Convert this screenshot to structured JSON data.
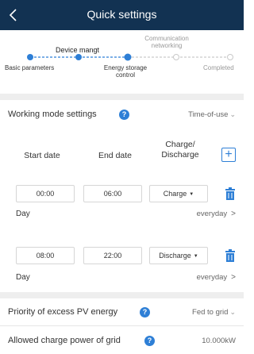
{
  "header": {
    "title": "Quick settings",
    "back_icon": "chevron-left-icon"
  },
  "steps": {
    "top": [
      {
        "label": "Device mangt",
        "state": "done"
      },
      {
        "label": "Communication networking",
        "line1": "Communication",
        "line2": "networking",
        "state": "pending"
      }
    ],
    "bottom": [
      {
        "label": "Basic parameters",
        "state": "done"
      },
      {
        "label": "Energy storage control",
        "line1": "Energy storage",
        "line2": "control",
        "state": "current"
      },
      {
        "label": "Completed",
        "state": "pending"
      }
    ],
    "colors": {
      "done": "#2e7fd6",
      "pending": "#c9c9c9"
    }
  },
  "working_mode": {
    "label": "Working mode settings",
    "value": "Time-of-use"
  },
  "schedule": {
    "start_header": "Start date",
    "end_header": "End date",
    "mode_header_line1": "Charge/",
    "mode_header_line2": "Discharge",
    "rows": [
      {
        "start": "00:00",
        "end": "06:00",
        "mode": "Charge",
        "day_label": "Day",
        "day_value": "everyday"
      },
      {
        "start": "08:00",
        "end": "22:00",
        "mode": "Discharge",
        "day_label": "Day",
        "day_value": "everyday"
      }
    ]
  },
  "priority": {
    "label": "Priority of excess PV energy",
    "value": "Fed to grid"
  },
  "grid_charge": {
    "label": "Allowed charge power of grid",
    "value": "10.000kW"
  },
  "colors": {
    "header": "#123252",
    "accent": "#2e7fd6"
  }
}
